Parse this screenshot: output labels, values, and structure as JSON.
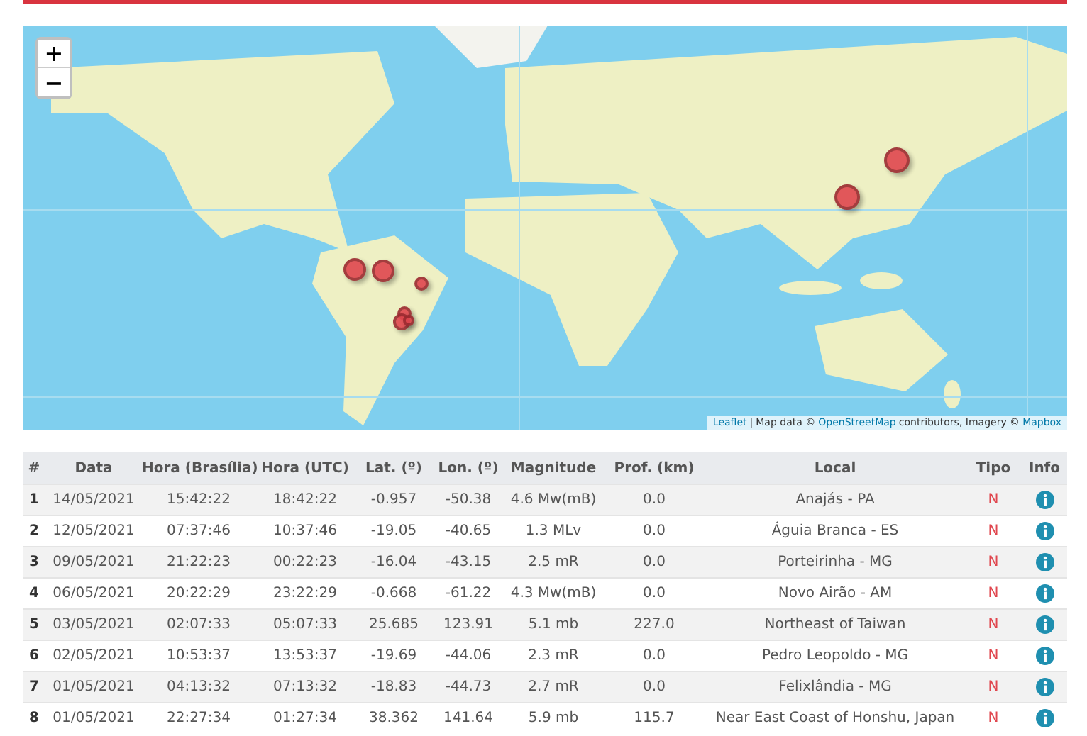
{
  "map": {
    "zoom_in": "+",
    "zoom_out": "−",
    "attribution": {
      "leaflet": "Leaflet",
      "sep": "|",
      "map_data": "Map data ©",
      "osm": "OpenStreetMap",
      "contributors": "contributors, Imagery ©",
      "mapbox": "Mapbox"
    }
  },
  "table": {
    "columns": [
      "#",
      "Data",
      "Hora (Brasília)",
      "Hora (UTC)",
      "Lat. (º)",
      "Lon. (º)",
      "Magnitude",
      "Prof. (km)",
      "Local",
      "Tipo",
      "Info"
    ],
    "rows": [
      {
        "n": "1",
        "date": "14/05/2021",
        "time_brt": "15:42:22",
        "time_utc": "18:42:22",
        "lat": "-0.957",
        "lon": "-50.38",
        "magnitude": "4.6 Mw(mB)",
        "depth": "0.0",
        "place": "Anajás - PA",
        "type": "N"
      },
      {
        "n": "2",
        "date": "12/05/2021",
        "time_brt": "07:37:46",
        "time_utc": "10:37:46",
        "lat": "-19.05",
        "lon": "-40.65",
        "magnitude": "1.3 MLv",
        "depth": "0.0",
        "place": "Águia Branca - ES",
        "type": "N"
      },
      {
        "n": "3",
        "date": "09/05/2021",
        "time_brt": "21:22:23",
        "time_utc": "00:22:23",
        "lat": "-16.04",
        "lon": "-43.15",
        "magnitude": "2.5 mR",
        "depth": "0.0",
        "place": "Porteirinha - MG",
        "type": "N"
      },
      {
        "n": "4",
        "date": "06/05/2021",
        "time_brt": "20:22:29",
        "time_utc": "23:22:29",
        "lat": "-0.668",
        "lon": "-61.22",
        "magnitude": "4.3 Mw(mB)",
        "depth": "0.0",
        "place": "Novo Airão - AM",
        "type": "N"
      },
      {
        "n": "5",
        "date": "03/05/2021",
        "time_brt": "02:07:33",
        "time_utc": "05:07:33",
        "lat": "25.685",
        "lon": "123.91",
        "magnitude": "5.1 mb",
        "depth": "227.0",
        "place": "Northeast of Taiwan",
        "type": "N"
      },
      {
        "n": "6",
        "date": "02/05/2021",
        "time_brt": "10:53:37",
        "time_utc": "13:53:37",
        "lat": "-19.69",
        "lon": "-44.06",
        "magnitude": "2.3 mR",
        "depth": "0.0",
        "place": "Pedro Leopoldo - MG",
        "type": "N"
      },
      {
        "n": "7",
        "date": "01/05/2021",
        "time_brt": "04:13:32",
        "time_utc": "07:13:32",
        "lat": "-18.83",
        "lon": "-44.73",
        "magnitude": "2.7 mR",
        "depth": "0.0",
        "place": "Felixlândia - MG",
        "type": "N"
      },
      {
        "n": "8",
        "date": "01/05/2021",
        "time_brt": "22:27:34",
        "time_utc": "01:27:34",
        "lat": "38.362",
        "lon": "141.64",
        "magnitude": "5.9 mb",
        "depth": "115.7",
        "place": "Near East Coast of Honshu, Japan",
        "type": "N"
      }
    ]
  }
}
